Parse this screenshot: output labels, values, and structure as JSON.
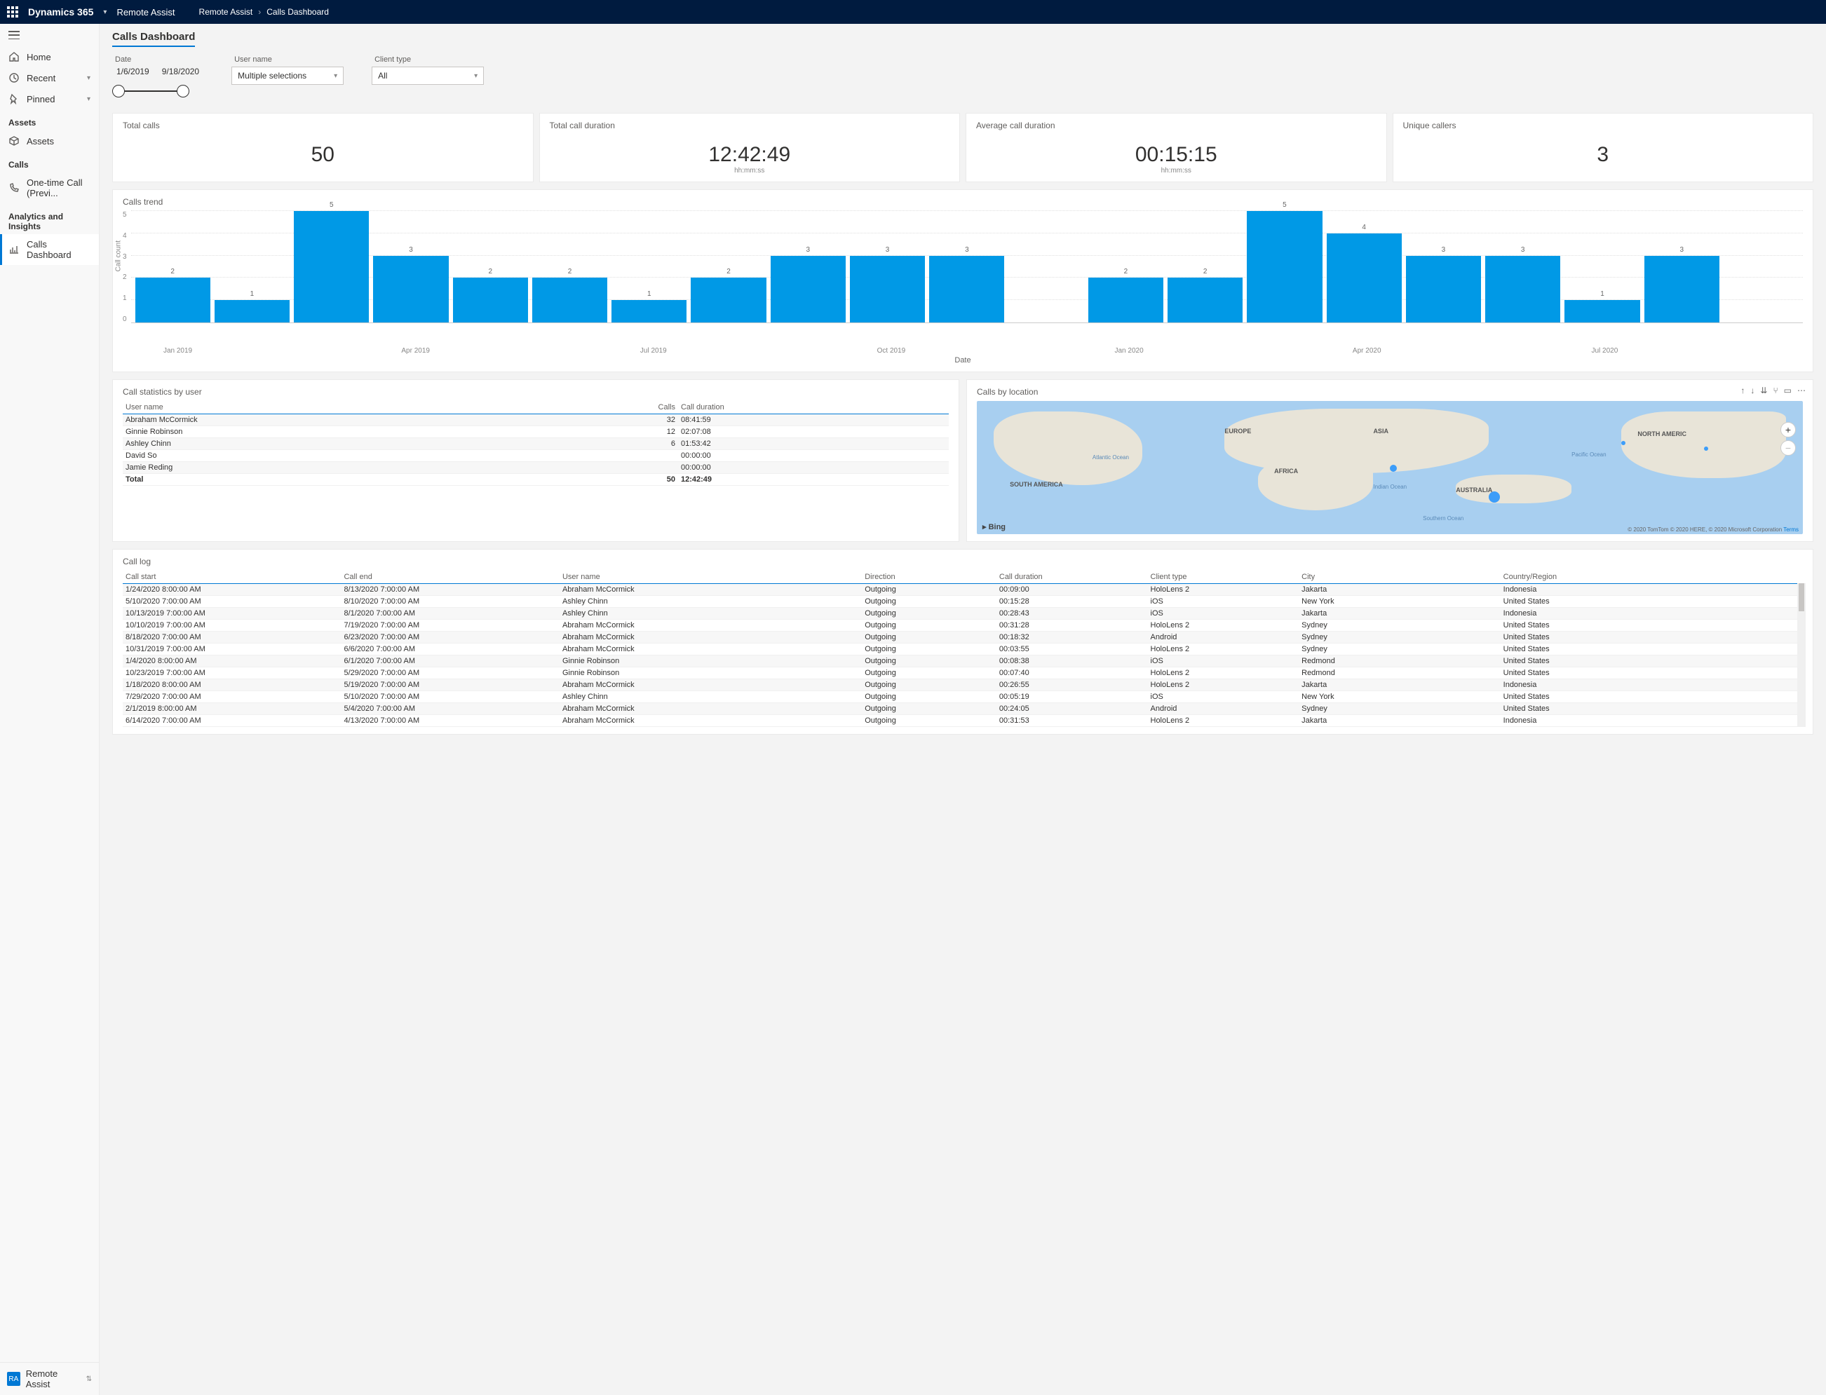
{
  "topbar": {
    "brand": "Dynamics 365",
    "app": "Remote Assist",
    "breadcrumb1": "Remote Assist",
    "breadcrumb2": "Calls Dashboard"
  },
  "sidebar": {
    "home": "Home",
    "recent": "Recent",
    "pinned": "Pinned",
    "assets_hdr": "Assets",
    "assets": "Assets",
    "calls_hdr": "Calls",
    "onetime": "One-time Call (Previ...",
    "ai_hdr": "Analytics and Insights",
    "dash": "Calls Dashboard",
    "footer_badge": "RA",
    "footer_label": "Remote Assist"
  },
  "page": {
    "title": "Calls Dashboard"
  },
  "filters": {
    "date_label": "Date",
    "date_from": "1/6/2019",
    "date_to": "9/18/2020",
    "user_label": "User name",
    "user_value": "Multiple selections",
    "client_label": "Client type",
    "client_value": "All"
  },
  "kpi": {
    "total_calls_label": "Total calls",
    "total_calls": "50",
    "total_dur_label": "Total call duration",
    "total_dur": "12:42:49",
    "dur_sub": "hh:mm:ss",
    "avg_dur_label": "Average call duration",
    "avg_dur": "00:15:15",
    "unique_label": "Unique callers",
    "unique": "3"
  },
  "chart_data": {
    "type": "bar",
    "title": "Calls trend",
    "ylabel": "Call count",
    "xlabel": "Date",
    "ylim": [
      0,
      5
    ],
    "yticks": [
      0,
      1,
      2,
      3,
      4,
      5
    ],
    "categories": [
      "Jan 2019",
      "Feb 2019",
      "Mar 2019",
      "Apr 2019",
      "May 2019",
      "Jun 2019",
      "Jul 2019",
      "Aug 2019",
      "Sep 2019",
      "Oct 2019",
      "Nov 2019",
      "Dec 2019",
      "Jan 2020",
      "Feb 2020",
      "Mar 2020",
      "Apr 2020",
      "May 2020",
      "Jun 2020",
      "Jul 2020",
      "Aug 2020",
      "Sep 2020"
    ],
    "values": [
      2,
      1,
      5,
      3,
      2,
      2,
      1,
      2,
      3,
      3,
      3,
      0,
      2,
      2,
      5,
      4,
      3,
      3,
      1,
      3,
      0
    ],
    "x_tick_labels": [
      "Jan 2019",
      "Apr 2019",
      "Jul 2019",
      "Oct 2019",
      "Jan 2020",
      "Apr 2020",
      "Jul 2020"
    ]
  },
  "stats": {
    "title": "Call statistics by user",
    "col_user": "User name",
    "col_calls": "Calls",
    "col_dur": "Call duration",
    "rows": [
      {
        "user": "Abraham McCormick",
        "calls": "32",
        "dur": "08:41:59"
      },
      {
        "user": "Ginnie Robinson",
        "calls": "12",
        "dur": "02:07:08"
      },
      {
        "user": "Ashley Chinn",
        "calls": "6",
        "dur": "01:53:42"
      },
      {
        "user": "David So",
        "calls": "",
        "dur": "00:00:00"
      },
      {
        "user": "Jamie Reding",
        "calls": "",
        "dur": "00:00:00"
      }
    ],
    "total_label": "Total",
    "total_calls": "50",
    "total_dur": "12:42:49"
  },
  "map": {
    "title": "Calls by location",
    "attr": "© 2020 TomTom © 2020 HERE, © 2020 Microsoft Corporation",
    "terms": "Terms",
    "bing": "Bing",
    "labels": {
      "eu": "EUROPE",
      "asia": "ASIA",
      "na": "NORTH AMERIC",
      "af": "AFRICA",
      "sa": "SOUTH AMERICA",
      "au": "AUSTRALIA",
      "atl": "Atlantic\nOcean",
      "ind": "Indian\nOcean",
      "pac": "Pacific\nOcean",
      "so": "Southern Ocean"
    }
  },
  "log": {
    "title": "Call log",
    "cols": {
      "start": "Call start",
      "end": "Call end",
      "user": "User name",
      "dir": "Direction",
      "dur": "Call duration",
      "client": "Client type",
      "city": "City",
      "country": "Country/Region"
    },
    "rows": [
      {
        "start": "1/24/2020 8:00:00 AM",
        "end": "8/13/2020 7:00:00 AM",
        "user": "Abraham McCormick",
        "dir": "Outgoing",
        "dur": "00:09:00",
        "client": "HoloLens 2",
        "city": "Jakarta",
        "country": "Indonesia"
      },
      {
        "start": "5/10/2020 7:00:00 AM",
        "end": "8/10/2020 7:00:00 AM",
        "user": "Ashley Chinn",
        "dir": "Outgoing",
        "dur": "00:15:28",
        "client": "iOS",
        "city": "New York",
        "country": "United States"
      },
      {
        "start": "10/13/2019 7:00:00 AM",
        "end": "8/1/2020 7:00:00 AM",
        "user": "Ashley Chinn",
        "dir": "Outgoing",
        "dur": "00:28:43",
        "client": "iOS",
        "city": "Jakarta",
        "country": "Indonesia"
      },
      {
        "start": "10/10/2019 7:00:00 AM",
        "end": "7/19/2020 7:00:00 AM",
        "user": "Abraham McCormick",
        "dir": "Outgoing",
        "dur": "00:31:28",
        "client": "HoloLens 2",
        "city": "Sydney",
        "country": "United States"
      },
      {
        "start": "8/18/2020 7:00:00 AM",
        "end": "6/23/2020 7:00:00 AM",
        "user": "Abraham McCormick",
        "dir": "Outgoing",
        "dur": "00:18:32",
        "client": "Android",
        "city": "Sydney",
        "country": "United States"
      },
      {
        "start": "10/31/2019 7:00:00 AM",
        "end": "6/6/2020 7:00:00 AM",
        "user": "Abraham McCormick",
        "dir": "Outgoing",
        "dur": "00:03:55",
        "client": "HoloLens 2",
        "city": "Sydney",
        "country": "United States"
      },
      {
        "start": "1/4/2020 8:00:00 AM",
        "end": "6/1/2020 7:00:00 AM",
        "user": "Ginnie Robinson",
        "dir": "Outgoing",
        "dur": "00:08:38",
        "client": "iOS",
        "city": "Redmond",
        "country": "United States"
      },
      {
        "start": "10/23/2019 7:00:00 AM",
        "end": "5/29/2020 7:00:00 AM",
        "user": "Ginnie Robinson",
        "dir": "Outgoing",
        "dur": "00:07:40",
        "client": "HoloLens 2",
        "city": "Redmond",
        "country": "United States"
      },
      {
        "start": "1/18/2020 8:00:00 AM",
        "end": "5/19/2020 7:00:00 AM",
        "user": "Abraham McCormick",
        "dir": "Outgoing",
        "dur": "00:26:55",
        "client": "HoloLens 2",
        "city": "Jakarta",
        "country": "Indonesia"
      },
      {
        "start": "7/29/2020 7:00:00 AM",
        "end": "5/10/2020 7:00:00 AM",
        "user": "Ashley Chinn",
        "dir": "Outgoing",
        "dur": "00:05:19",
        "client": "iOS",
        "city": "New York",
        "country": "United States"
      },
      {
        "start": "2/1/2019 8:00:00 AM",
        "end": "5/4/2020 7:00:00 AM",
        "user": "Abraham McCormick",
        "dir": "Outgoing",
        "dur": "00:24:05",
        "client": "Android",
        "city": "Sydney",
        "country": "United States"
      },
      {
        "start": "6/14/2020 7:00:00 AM",
        "end": "4/13/2020 7:00:00 AM",
        "user": "Abraham McCormick",
        "dir": "Outgoing",
        "dur": "00:31:53",
        "client": "HoloLens 2",
        "city": "Jakarta",
        "country": "Indonesia"
      }
    ]
  }
}
